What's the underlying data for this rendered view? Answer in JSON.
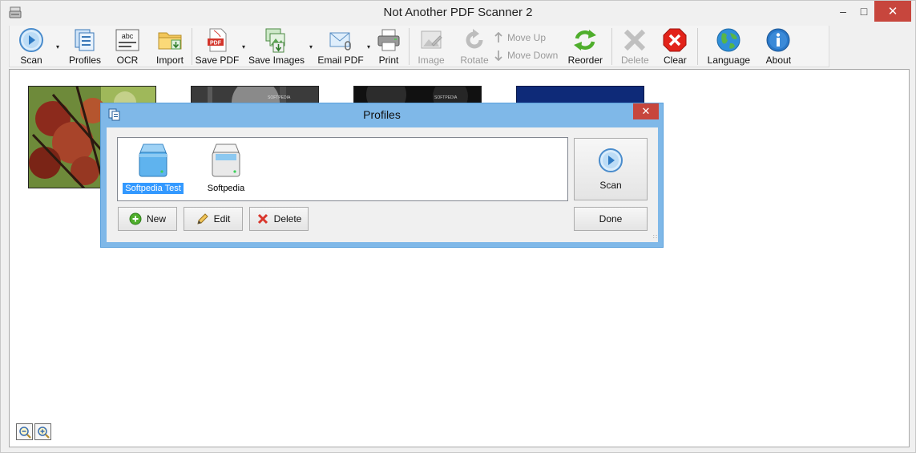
{
  "window": {
    "title": "Not Another PDF Scanner 2",
    "minimize_glyph": "‒",
    "maximize_glyph": "□",
    "close_glyph": "✕"
  },
  "toolbar": {
    "scan": "Scan",
    "profiles": "Profiles",
    "ocr": "OCR",
    "ocr_icon_text": "abc",
    "import": "Import",
    "save_pdf": "Save PDF",
    "pdf_icon_text": "PDF",
    "save_images": "Save Images",
    "email_pdf": "Email PDF",
    "print": "Print",
    "image": "Image",
    "rotate": "Rotate",
    "move_up": "Move Up",
    "move_down": "Move Down",
    "reorder": "Reorder",
    "delete": "Delete",
    "clear": "Clear",
    "language": "Language",
    "about": "About",
    "dropdown_glyph": "▾"
  },
  "thumbnails": [
    {
      "caption": ""
    },
    {
      "caption": "SOFTPEDIA"
    },
    {
      "caption": "SOFTPEDIA"
    },
    {
      "caption": ""
    }
  ],
  "dialog": {
    "title": "Profiles",
    "close_glyph": "✕",
    "profiles": [
      {
        "name": "Softpedia Test",
        "selected": true
      },
      {
        "name": "Softpedia",
        "selected": false
      }
    ],
    "buttons": {
      "new": "New",
      "edit": "Edit",
      "delete": "Delete",
      "scan": "Scan",
      "done": "Done"
    },
    "grip": "∷"
  },
  "colors": {
    "accent_blue": "#3399ff",
    "dialog_frame": "#7fb8e8",
    "close_red": "#c7463d"
  }
}
